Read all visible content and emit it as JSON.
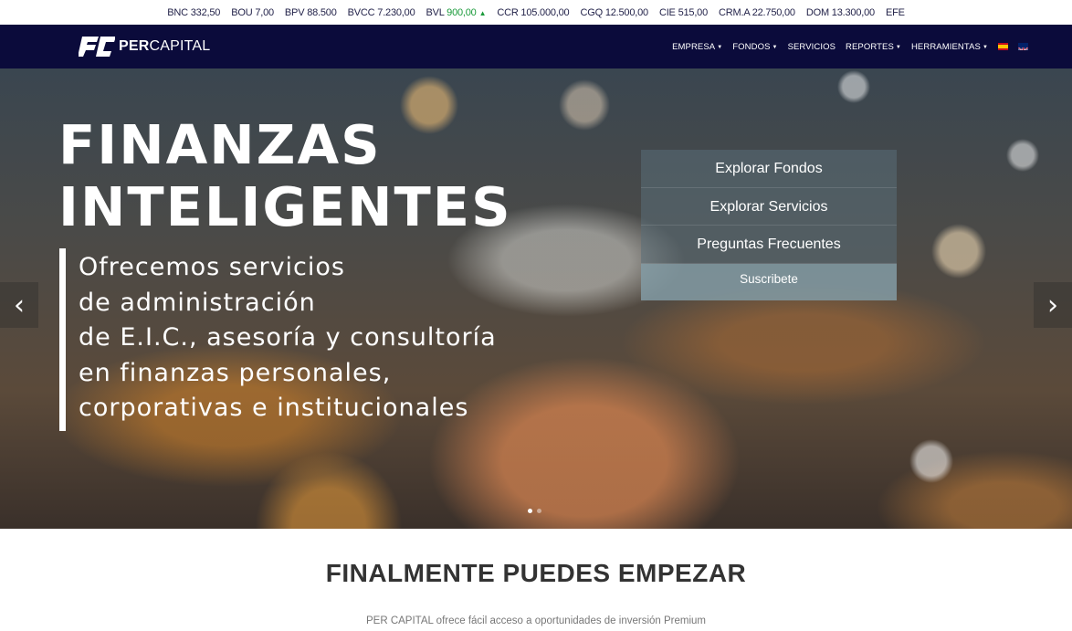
{
  "ticker": [
    {
      "symbol": "BNC",
      "value": "332,50",
      "trend": "none"
    },
    {
      "symbol": "BOU",
      "value": "7,00",
      "trend": "none"
    },
    {
      "symbol": "BPV",
      "value": "88.500",
      "trend": "none"
    },
    {
      "symbol": "BVCC",
      "value": "7.230,00",
      "trend": "none"
    },
    {
      "symbol": "BVL",
      "value": "900,00",
      "trend": "up"
    },
    {
      "symbol": "CCR",
      "value": "105.000,00",
      "trend": "none"
    },
    {
      "symbol": "CGQ",
      "value": "12.500,00",
      "trend": "none"
    },
    {
      "symbol": "CIE",
      "value": "515,00",
      "trend": "none"
    },
    {
      "symbol": "CRM.A",
      "value": "22.750,00",
      "trend": "none"
    },
    {
      "symbol": "DOM",
      "value": "13.300,00",
      "trend": "none"
    },
    {
      "symbol": "EFE",
      "value": "",
      "trend": "none"
    }
  ],
  "brand": {
    "bold": "PER",
    "light": "CAPITAL",
    "mark": "PC"
  },
  "nav": {
    "items": [
      {
        "label": "EMPRESA",
        "dropdown": true
      },
      {
        "label": "FONDOS",
        "dropdown": true
      },
      {
        "label": "SERVICIOS",
        "dropdown": false
      },
      {
        "label": "REPORTES",
        "dropdown": true
      },
      {
        "label": "HERRAMIENTAS",
        "dropdown": true
      }
    ],
    "languages": [
      "es-flag-icon",
      "uk-flag-icon"
    ]
  },
  "hero": {
    "title_line1": "FINANZAS",
    "title_line2": "INTELIGENTES",
    "subtitle_lines": [
      "Ofrecemos servicios",
      "de administración",
      "de E.I.C., asesoría y consultoría",
      "en finanzas personales,",
      "corporativas e institucionales"
    ],
    "panel": {
      "links": [
        "Explorar Fondos",
        "Explorar Servicios",
        "Preguntas Frecuentes"
      ],
      "subscribe": "Suscribete"
    },
    "prev_arrow": "‹",
    "next_arrow": "›",
    "slides": 2,
    "active_slide": 0
  },
  "section": {
    "title": "FINALMENTE PUEDES EMPEZAR",
    "subtitle": "PER CAPITAL ofrece fácil acceso a oportunidades de inversión Premium"
  },
  "colors": {
    "nav_bg": "#0b0b3b",
    "ticker_up": "#1a9a3a",
    "panel_button": "#829ba5"
  }
}
